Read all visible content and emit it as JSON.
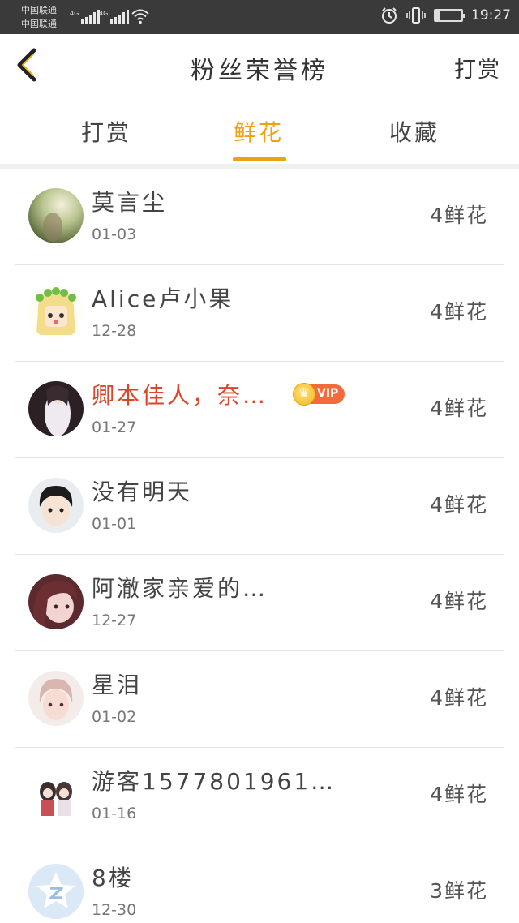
{
  "status_bar": {
    "carrier_1": "中国联通",
    "carrier_2": "中国联通",
    "network_1": "4G",
    "network_2": "4G",
    "battery_level": "19",
    "battery_percent": 19,
    "time": "19:27"
  },
  "header": {
    "title": "粉丝荣誉榜",
    "right_action": "打赏",
    "back_icon": "chevron-left-icon"
  },
  "tabs": [
    {
      "label": "打赏",
      "active": false
    },
    {
      "label": "鲜花",
      "active": true
    },
    {
      "label": "收藏",
      "active": false
    }
  ],
  "accent_color": "#f0a015",
  "fans": [
    {
      "name": "莫言尘",
      "date": "01-03",
      "count": "4鲜花",
      "vip": false
    },
    {
      "name": "Alice卢小果",
      "date": "12-28",
      "count": "4鲜花",
      "vip": false
    },
    {
      "name": "卿本佳人，奈…",
      "date": "01-27",
      "count": "4鲜花",
      "vip": true,
      "badge": "VIP"
    },
    {
      "name": "没有明天",
      "date": "01-01",
      "count": "4鲜花",
      "vip": false
    },
    {
      "name": "阿澈家亲爱的…",
      "date": "12-27",
      "count": "4鲜花",
      "vip": false
    },
    {
      "name": "星泪",
      "date": "01-02",
      "count": "4鲜花",
      "vip": false
    },
    {
      "name": "游客1577801961…",
      "date": "01-16",
      "count": "4鲜花",
      "vip": false
    },
    {
      "name": "8楼",
      "date": "12-30",
      "count": "3鲜花",
      "vip": false
    }
  ]
}
